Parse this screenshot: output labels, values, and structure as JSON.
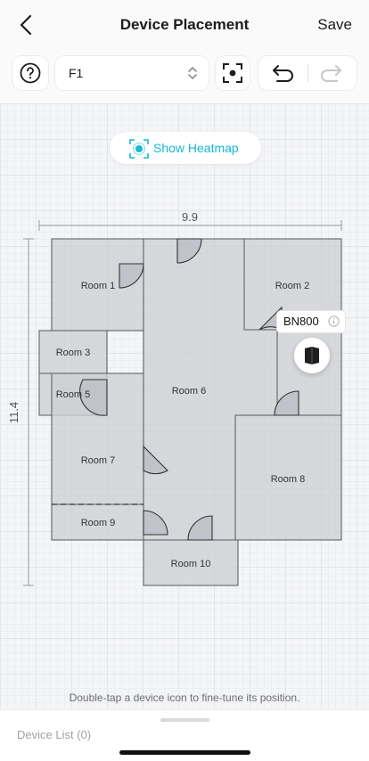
{
  "header": {
    "title": "Device Placement",
    "save_label": "Save",
    "back_icon": "chevron-left-icon"
  },
  "toolbar": {
    "help_icon": "help-icon",
    "floor": "F1",
    "floor_selector_icon": "chevron-up-down-icon",
    "focus_icon": "focus-frame-icon",
    "undo_icon": "undo-icon",
    "redo_icon": "redo-icon"
  },
  "heatmap": {
    "label": "Show Heatmap",
    "icon": "heatmap-icon",
    "accent": "#17b8d6"
  },
  "floorplan": {
    "width_label": "9.9",
    "height_label": "11.4",
    "rooms": [
      "Room 1",
      "Room 2",
      "Room 3",
      "Room 5",
      "Room 6",
      "Room 7",
      "Room 8",
      "Room 9",
      "Room 10"
    ]
  },
  "device": {
    "name": "BN800",
    "icon": "router-icon",
    "info_icon": "info-icon"
  },
  "hint": "Double-tap a device icon to fine-tune its position.",
  "device_list": {
    "label": "Device List (0)"
  }
}
